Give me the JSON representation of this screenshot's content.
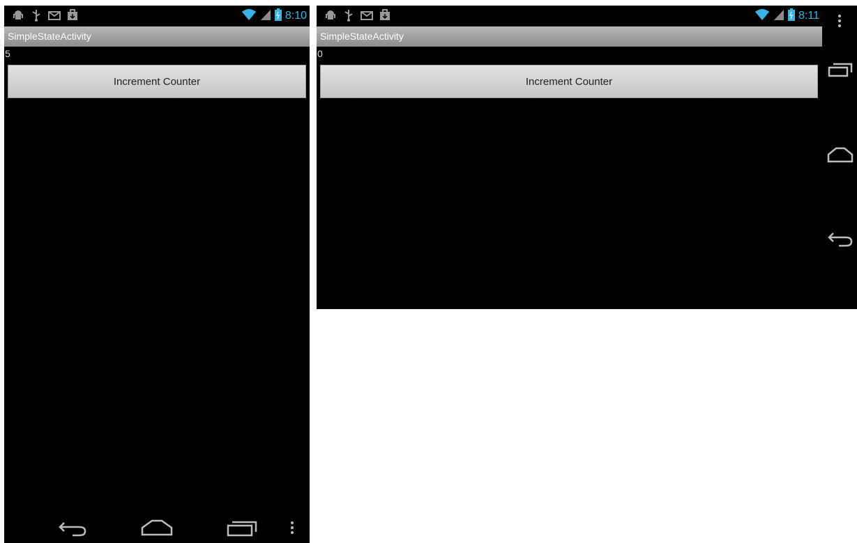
{
  "portrait": {
    "status": {
      "time": "8:10"
    },
    "app_title": "SimpleStateActivity",
    "counter_value": "5",
    "button_label": "Increment Counter"
  },
  "landscape": {
    "status": {
      "time": "8:11"
    },
    "app_title": "SimpleStateActivity",
    "counter_value": "0",
    "button_label": "Increment Counter"
  },
  "icons": {
    "status_left": [
      "android-debug-icon",
      "usb-icon",
      "gmail-icon",
      "download-bag-icon"
    ],
    "status_right": [
      "wifi-icon",
      "signal-icon",
      "battery-icon"
    ],
    "nav": [
      "back-icon",
      "home-icon",
      "recent-apps-icon",
      "overflow-menu-icon"
    ]
  },
  "colors": {
    "clock": "#33b5e5",
    "screen_bg": "#000000",
    "titlebar_bg": "#a0a0a0",
    "button_bg": "#d4d4d4"
  }
}
